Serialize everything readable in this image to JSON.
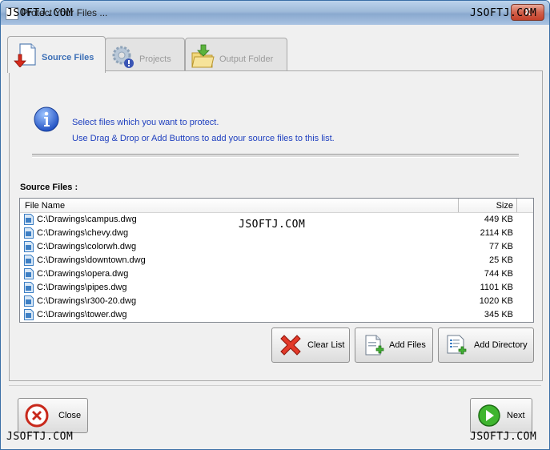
{
  "window": {
    "title": "Protect Your Files ...",
    "close_symbol": "X"
  },
  "watermarks": [
    "JSOFTJ.COM",
    "JSOFTJ.COM",
    "JSOFTJ.COM",
    "JSOFTJ.COM",
    "JSOFTJ.COM"
  ],
  "tabs": [
    {
      "label": "Source Files",
      "icon": "source-files-icon",
      "active": true
    },
    {
      "label": "Projects",
      "icon": "projects-gear-icon",
      "active": false
    },
    {
      "label": "Output Folder",
      "icon": "output-folder-icon",
      "active": false
    }
  ],
  "info": {
    "icon": "info-icon",
    "line1": "Select files which you want to protect.",
    "line2": "Use Drag & Drop or Add Buttons to add your source files to this list."
  },
  "source_files_label": "Source Files :",
  "table": {
    "columns": [
      "File Name",
      "Size"
    ],
    "rows": [
      {
        "name": "C:\\Drawings\\campus.dwg",
        "size": "449 KB"
      },
      {
        "name": "C:\\Drawings\\chevy.dwg",
        "size": "2114 KB"
      },
      {
        "name": "C:\\Drawings\\colorwh.dwg",
        "size": "77 KB"
      },
      {
        "name": "C:\\Drawings\\downtown.dwg",
        "size": "25 KB"
      },
      {
        "name": "C:\\Drawings\\opera.dwg",
        "size": "744 KB"
      },
      {
        "name": "C:\\Drawings\\pipes.dwg",
        "size": "1101 KB"
      },
      {
        "name": "C:\\Drawings\\r300-20.dwg",
        "size": "1020 KB"
      },
      {
        "name": "C:\\Drawings\\tower.dwg",
        "size": "345 KB"
      }
    ]
  },
  "buttons": {
    "clear_list": "Clear List",
    "add_files": "Add Files",
    "add_directory": "Add Directory",
    "close": "Close",
    "next": "Next"
  },
  "colors": {
    "info_text": "#1e3fbf",
    "active_tab": "#3c6fb6",
    "file_icon": "#3d7fc4"
  }
}
